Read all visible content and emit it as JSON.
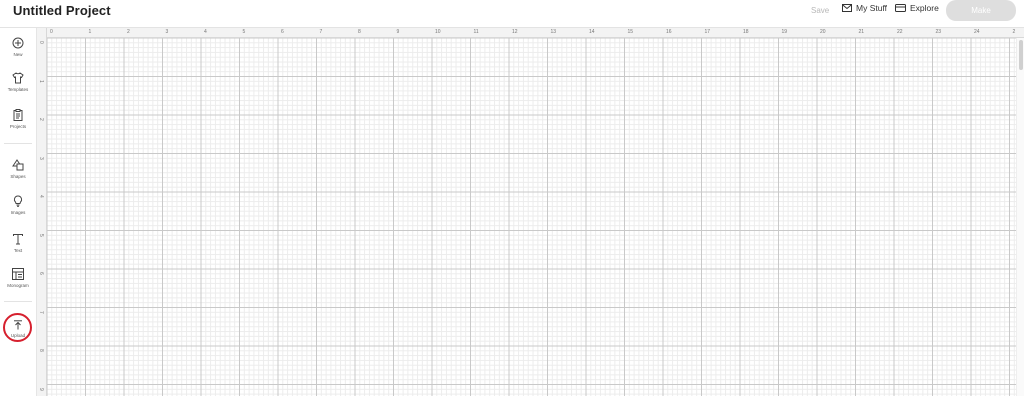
{
  "app": {
    "title": "Untitled Project"
  },
  "header": {
    "save_label": "Save",
    "mystuff_label": "My Stuff",
    "explore_label": "Explore",
    "make_label": "Make"
  },
  "sidebar": {
    "items": [
      {
        "label": "New",
        "icon": "plus-circle-icon"
      },
      {
        "label": "Templates",
        "icon": "shirt-icon"
      },
      {
        "label": "Projects",
        "icon": "clipboard-icon"
      },
      {
        "label": "Shapes",
        "icon": "shapes-icon"
      },
      {
        "label": "Images",
        "icon": "lightbulb-icon"
      },
      {
        "label": "Text",
        "icon": "text-icon"
      },
      {
        "label": "Monogram",
        "icon": "monogram-icon"
      },
      {
        "label": "Upload",
        "icon": "upload-icon"
      }
    ],
    "highlight": {
      "item": "Upload",
      "color": "#d6202e"
    }
  },
  "rulers": {
    "top_ticks": [
      "0",
      "1",
      "2",
      "3",
      "4",
      "5",
      "6",
      "7",
      "8",
      "9",
      "10",
      "11",
      "12",
      "13",
      "14",
      "15",
      "16",
      "17",
      "18",
      "19",
      "20",
      "21",
      "22",
      "23",
      "24",
      "2"
    ],
    "left_ticks": [
      "0",
      "1",
      "2",
      "3",
      "4",
      "5",
      "6",
      "7",
      "8",
      "9"
    ]
  },
  "colors": {
    "accent": "#d6202e",
    "make_button_bg": "#dedede"
  }
}
